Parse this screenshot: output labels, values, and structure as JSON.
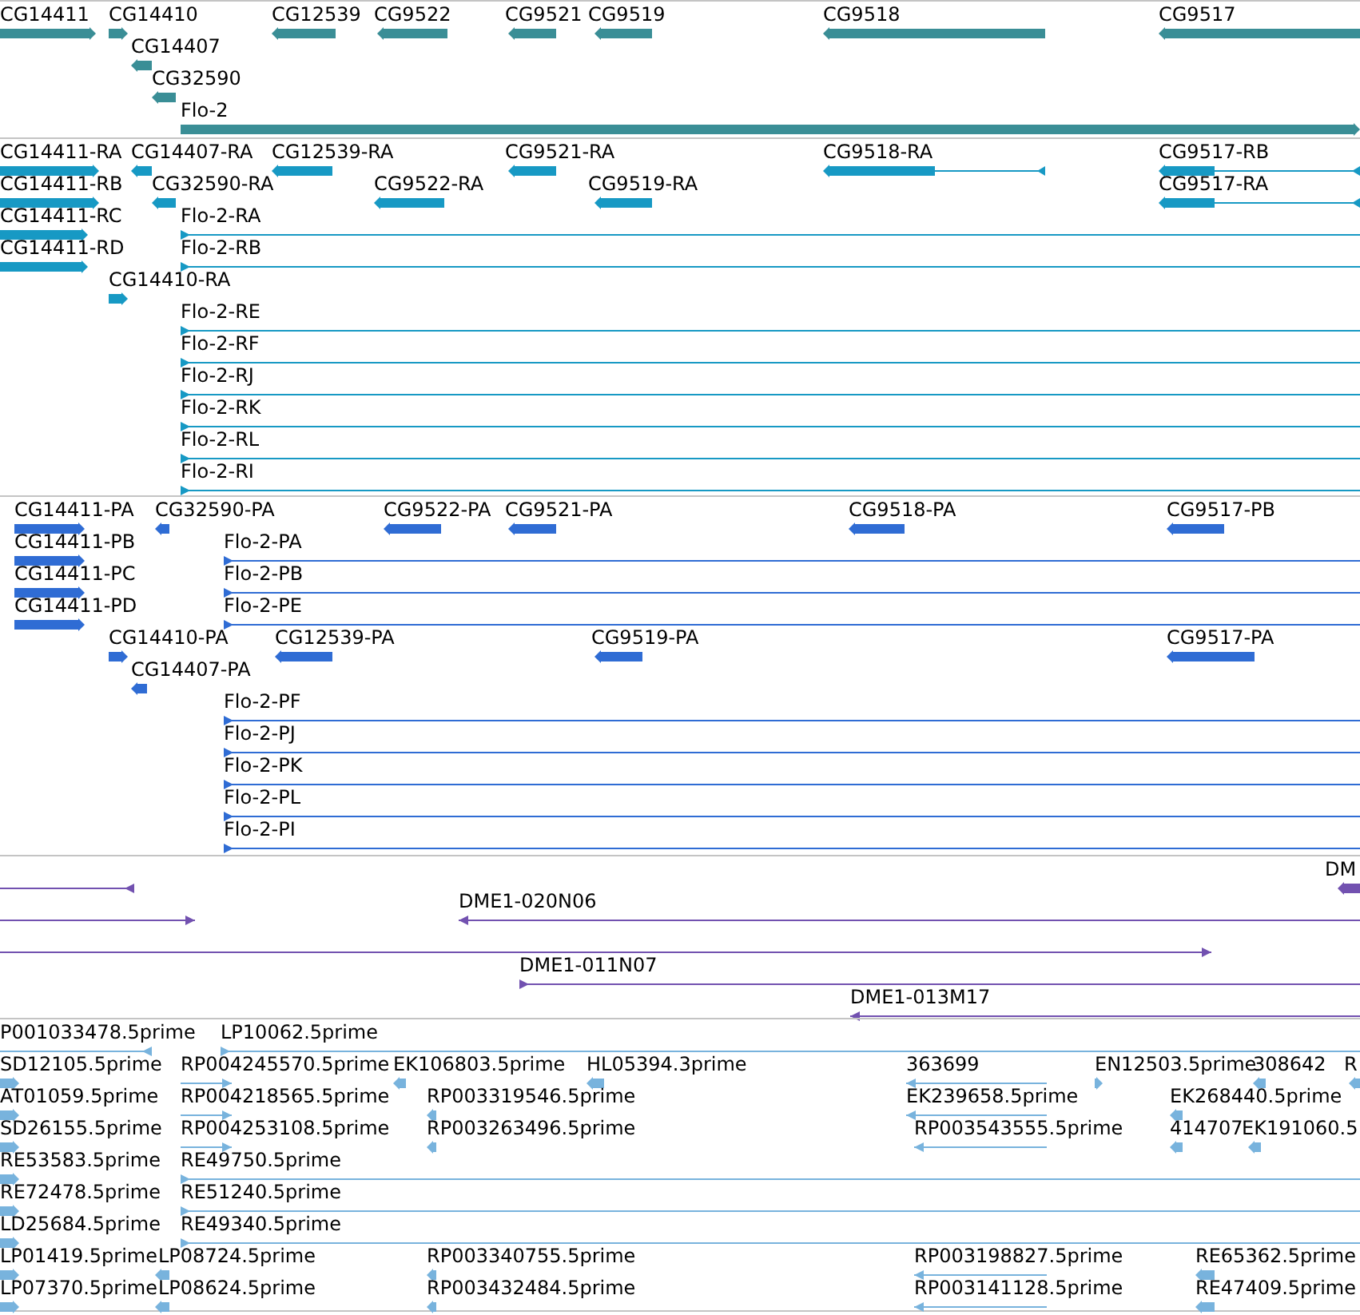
{
  "tracks": [
    {
      "kind": "gene",
      "features": [
        {
          "label": "CG14411",
          "forward": true
        },
        {
          "label": "CG14410",
          "forward": true
        },
        {
          "label": "CG12539",
          "forward": false
        },
        {
          "label": "CG9522",
          "forward": false
        },
        {
          "label": "CG9521",
          "forward": false
        },
        {
          "label": "CG9519",
          "forward": false
        },
        {
          "label": "CG9518",
          "forward": false
        },
        {
          "label": "CG9517",
          "forward": false
        },
        {
          "label": "CG14407",
          "forward": false
        },
        {
          "label": "CG32590",
          "forward": false
        },
        {
          "label": "Flo-2",
          "forward": true
        }
      ]
    },
    {
      "kind": "transcript",
      "features": [
        {
          "label": "CG14411-RA",
          "forward": true
        },
        {
          "label": "CG14407-RA",
          "forward": false
        },
        {
          "label": "CG12539-RA",
          "forward": false
        },
        {
          "label": "CG9521-RA",
          "forward": false
        },
        {
          "label": "CG9518-RA",
          "forward": false
        },
        {
          "label": "CG9517-RB",
          "forward": false
        },
        {
          "label": "CG14411-RB",
          "forward": true
        },
        {
          "label": "CG32590-RA",
          "forward": false
        },
        {
          "label": "CG9522-RA",
          "forward": false
        },
        {
          "label": "CG9519-RA",
          "forward": false
        },
        {
          "label": "CG9517-RA",
          "forward": false
        },
        {
          "label": "CG14411-RC",
          "forward": true
        },
        {
          "label": "Flo-2-RA",
          "forward": true
        },
        {
          "label": "CG14411-RD",
          "forward": true
        },
        {
          "label": "Flo-2-RB",
          "forward": true
        },
        {
          "label": "CG14410-RA",
          "forward": true
        },
        {
          "label": "Flo-2-RE",
          "forward": true
        },
        {
          "label": "Flo-2-RF",
          "forward": true
        },
        {
          "label": "Flo-2-RJ",
          "forward": true
        },
        {
          "label": "Flo-2-RK",
          "forward": true
        },
        {
          "label": "Flo-2-RL",
          "forward": true
        },
        {
          "label": "Flo-2-RI",
          "forward": true
        }
      ]
    },
    {
      "kind": "protein",
      "features": [
        {
          "label": "CG14411-PA",
          "forward": true
        },
        {
          "label": "CG32590-PA",
          "forward": false
        },
        {
          "label": "CG9522-PA",
          "forward": false
        },
        {
          "label": "CG9521-PA",
          "forward": false
        },
        {
          "label": "CG9518-PA",
          "forward": false
        },
        {
          "label": "CG9517-PB",
          "forward": false
        },
        {
          "label": "CG14411-PB",
          "forward": true
        },
        {
          "label": "Flo-2-PA",
          "forward": true
        },
        {
          "label": "CG14411-PC",
          "forward": true
        },
        {
          "label": "Flo-2-PB",
          "forward": true
        },
        {
          "label": "CG14411-PD",
          "forward": true
        },
        {
          "label": "Flo-2-PE",
          "forward": true
        },
        {
          "label": "CG14410-PA",
          "forward": true
        },
        {
          "label": "CG12539-PA",
          "forward": false
        },
        {
          "label": "CG9519-PA",
          "forward": false
        },
        {
          "label": "CG9517-PA",
          "forward": false
        },
        {
          "label": "CG14407-PA",
          "forward": false
        },
        {
          "label": "Flo-2-PF",
          "forward": true
        },
        {
          "label": "Flo-2-PJ",
          "forward": true
        },
        {
          "label": "Flo-2-PK",
          "forward": true
        },
        {
          "label": "Flo-2-PL",
          "forward": true
        },
        {
          "label": "Flo-2-PI",
          "forward": true
        }
      ]
    },
    {
      "kind": "clone",
      "features": [
        {
          "forward": false
        },
        {
          "label": "DM",
          "forward": false
        },
        {
          "forward": true
        },
        {
          "label": "DME1-020N06",
          "forward": false
        },
        {
          "forward": true
        },
        {
          "label": "DME1-011N07",
          "forward": true
        },
        {
          "label": "DME1-013M17",
          "forward": false
        }
      ]
    },
    {
      "kind": "est",
      "features": [
        {
          "label": "P001033478.5prime",
          "forward": false
        },
        {
          "label": "LP10062.5prime",
          "forward": true
        },
        {
          "label": "SD12105.5prime",
          "forward": true
        },
        {
          "label": "RP004245570.5prime",
          "forward": true
        },
        {
          "label": "EK106803.5prime",
          "forward": false
        },
        {
          "label": "HL05394.3prime",
          "forward": false
        },
        {
          "label": "363699",
          "forward": false
        },
        {
          "label": "EN12503.5prime",
          "forward": true
        },
        {
          "label": "308642",
          "forward": false
        },
        {
          "label": "R",
          "forward": false
        },
        {
          "label": "AT01059.5prime",
          "forward": true
        },
        {
          "label": "RP004218565.5prime",
          "forward": true
        },
        {
          "label": "RP003319546.5prime",
          "forward": false
        },
        {
          "label": "EK239658.5prime",
          "forward": false
        },
        {
          "label": "EK268440.5prime",
          "forward": false
        },
        {
          "label": "SD26155.5prime",
          "forward": true
        },
        {
          "label": "RP004253108.5prime",
          "forward": true
        },
        {
          "label": "RP003263496.5prime",
          "forward": false
        },
        {
          "label": "RP003543555.5prime",
          "forward": false
        },
        {
          "label": "414707",
          "forward": false
        },
        {
          "label": "EK191060.5",
          "forward": false
        },
        {
          "label": "RE53583.5prime",
          "forward": true
        },
        {
          "label": "RE49750.5prime",
          "forward": true
        },
        {
          "label": "RE72478.5prime",
          "forward": true
        },
        {
          "label": "RE51240.5prime",
          "forward": true
        },
        {
          "label": "LD25684.5prime",
          "forward": true
        },
        {
          "label": "RE49340.5prime",
          "forward": true
        },
        {
          "label": "LP01419.5prime",
          "forward": true
        },
        {
          "label": "LP08724.5prime",
          "forward": false
        },
        {
          "label": "RP003340755.5prime",
          "forward": false
        },
        {
          "label": "RP003198827.5prime",
          "forward": false
        },
        {
          "label": "RE65362.5prime",
          "forward": false
        },
        {
          "label": "LP07370.5prime",
          "forward": true
        },
        {
          "label": "LP08624.5prime",
          "forward": false
        },
        {
          "label": "RP003432484.5prime",
          "forward": false
        },
        {
          "label": "RP003141128.5prime",
          "forward": false
        },
        {
          "label": "RE47409.5prime",
          "forward": false
        }
      ]
    }
  ]
}
